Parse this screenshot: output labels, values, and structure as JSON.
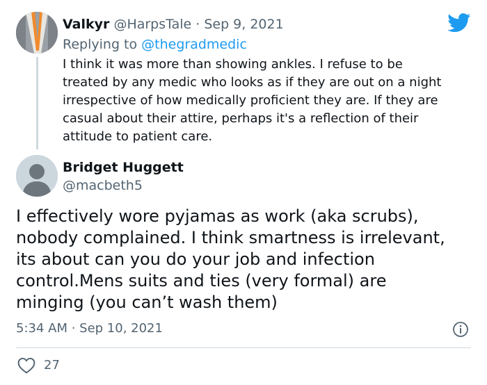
{
  "parent_tweet": {
    "display_name": "Valkyr",
    "meta": "@HarpsTale · Sep 9, 2021",
    "replying_prefix": "Replying to ",
    "replying_handle": "@thegradmedic",
    "text": "I think it was more than showing ankles.  I refuse to be\ntreated by any medic who looks as if they are out on a night\nirrespective of how medically proficient they are.  If they are\ncasual about their attire, perhaps it's a reflection of their\nattitude to patient care."
  },
  "main_tweet": {
    "display_name": "Bridget Huggett",
    "handle": "@macbeth5",
    "text": "I effectively wore pyjamas as work (aka scrubs),\nnobody complained. I think smartness is irrelevant,\nits about can  you do your job  and infection\ncontrol.Mens suits and ties (very formal) are\nminging (you can’t wash them)",
    "timestamp": "5:34 AM · Sep 10, 2021",
    "like_count": "27"
  },
  "icons": {
    "brand": "twitter-bird-icon",
    "info": "info-icon",
    "like": "heart-icon"
  },
  "colors": {
    "brand_blue": "#1d9bf0",
    "secondary_text": "#536471",
    "divider": "#cfd9de"
  }
}
